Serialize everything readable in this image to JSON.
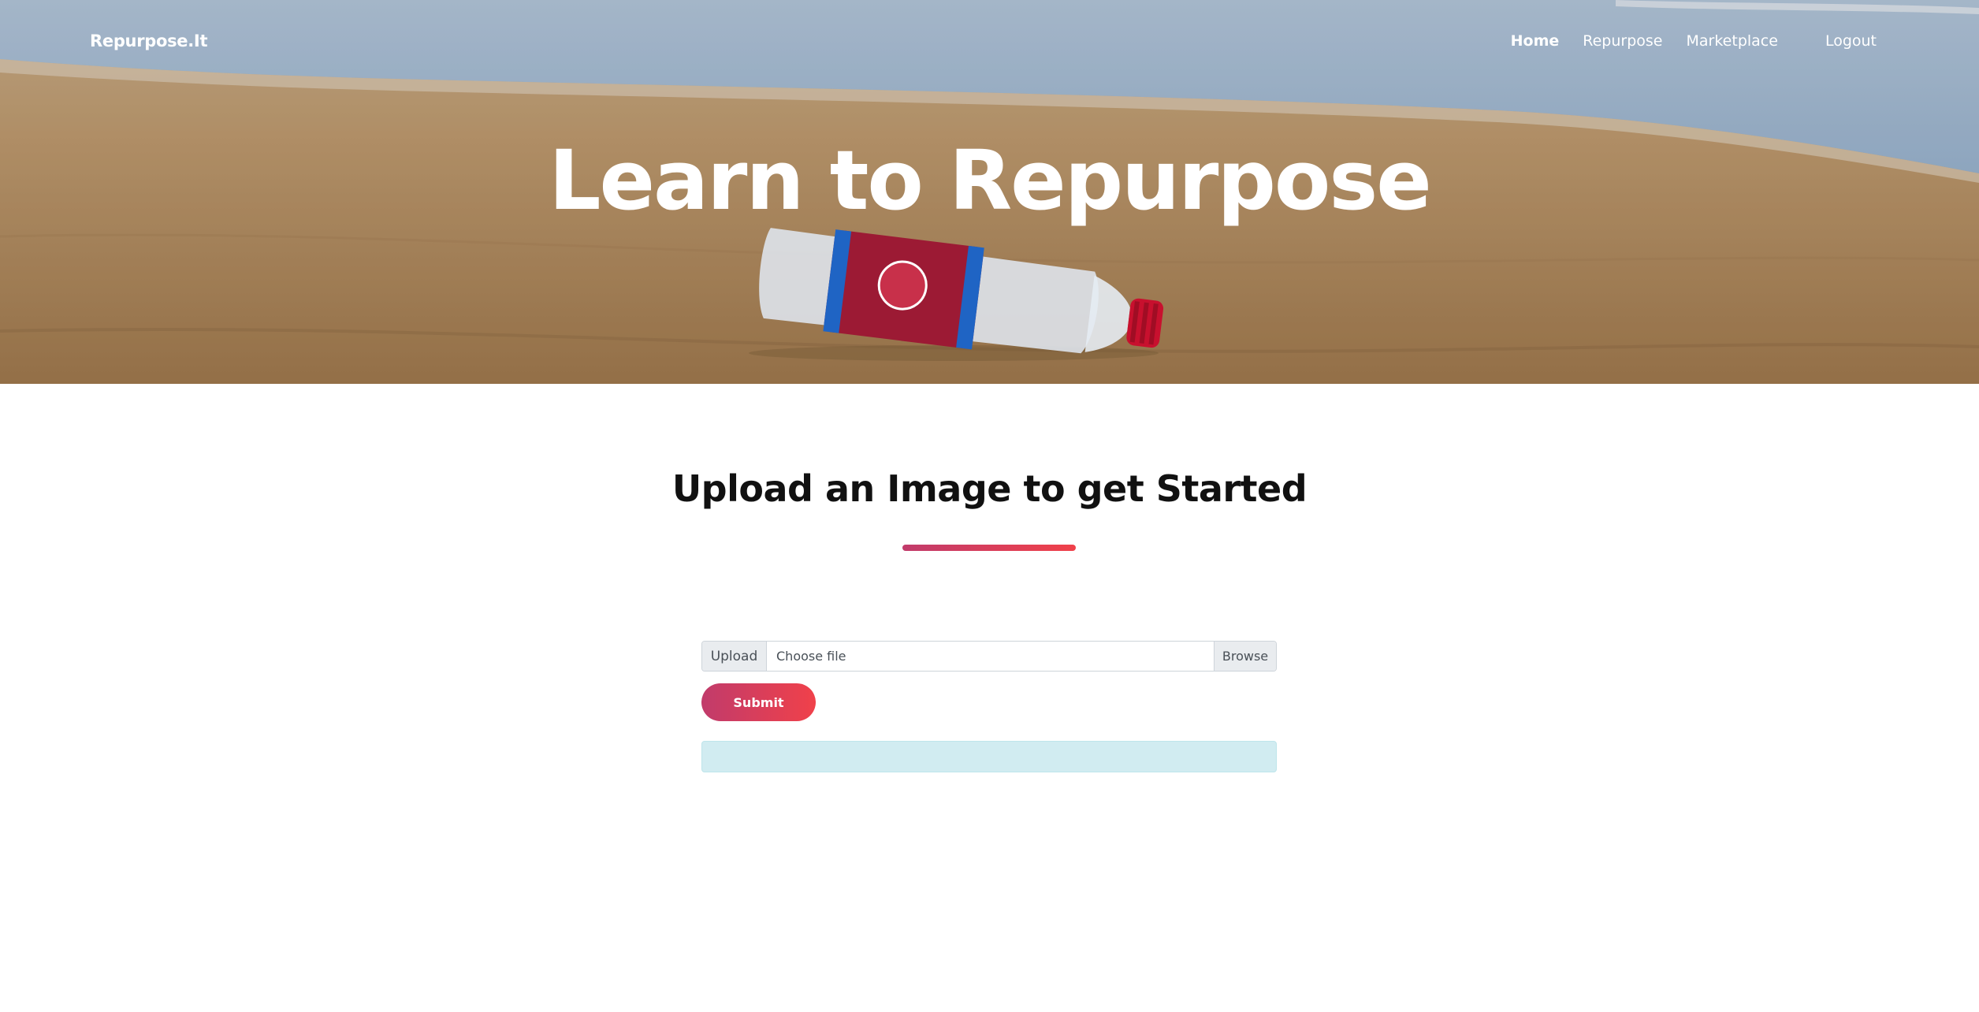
{
  "navbar": {
    "brand": "Repurpose.It",
    "links": [
      {
        "label": "Home",
        "active": true
      },
      {
        "label": "Repurpose",
        "active": false
      },
      {
        "label": "Marketplace",
        "active": false
      }
    ],
    "logout": "Logout"
  },
  "hero": {
    "title": "Learn to Repurpose"
  },
  "main": {
    "section_title": "Upload an Image to get Started",
    "upload": {
      "prepend_label": "Upload",
      "file_placeholder": "Choose file",
      "browse_label": "Browse"
    },
    "submit_label": "Submit",
    "result_text": ""
  },
  "colors": {
    "accent_start": "#c13b6b",
    "accent_end": "#f0414a",
    "info_bg": "#d1ecf1"
  },
  "icons": {
    "hero_image": "plastic-bottle-on-beach"
  }
}
